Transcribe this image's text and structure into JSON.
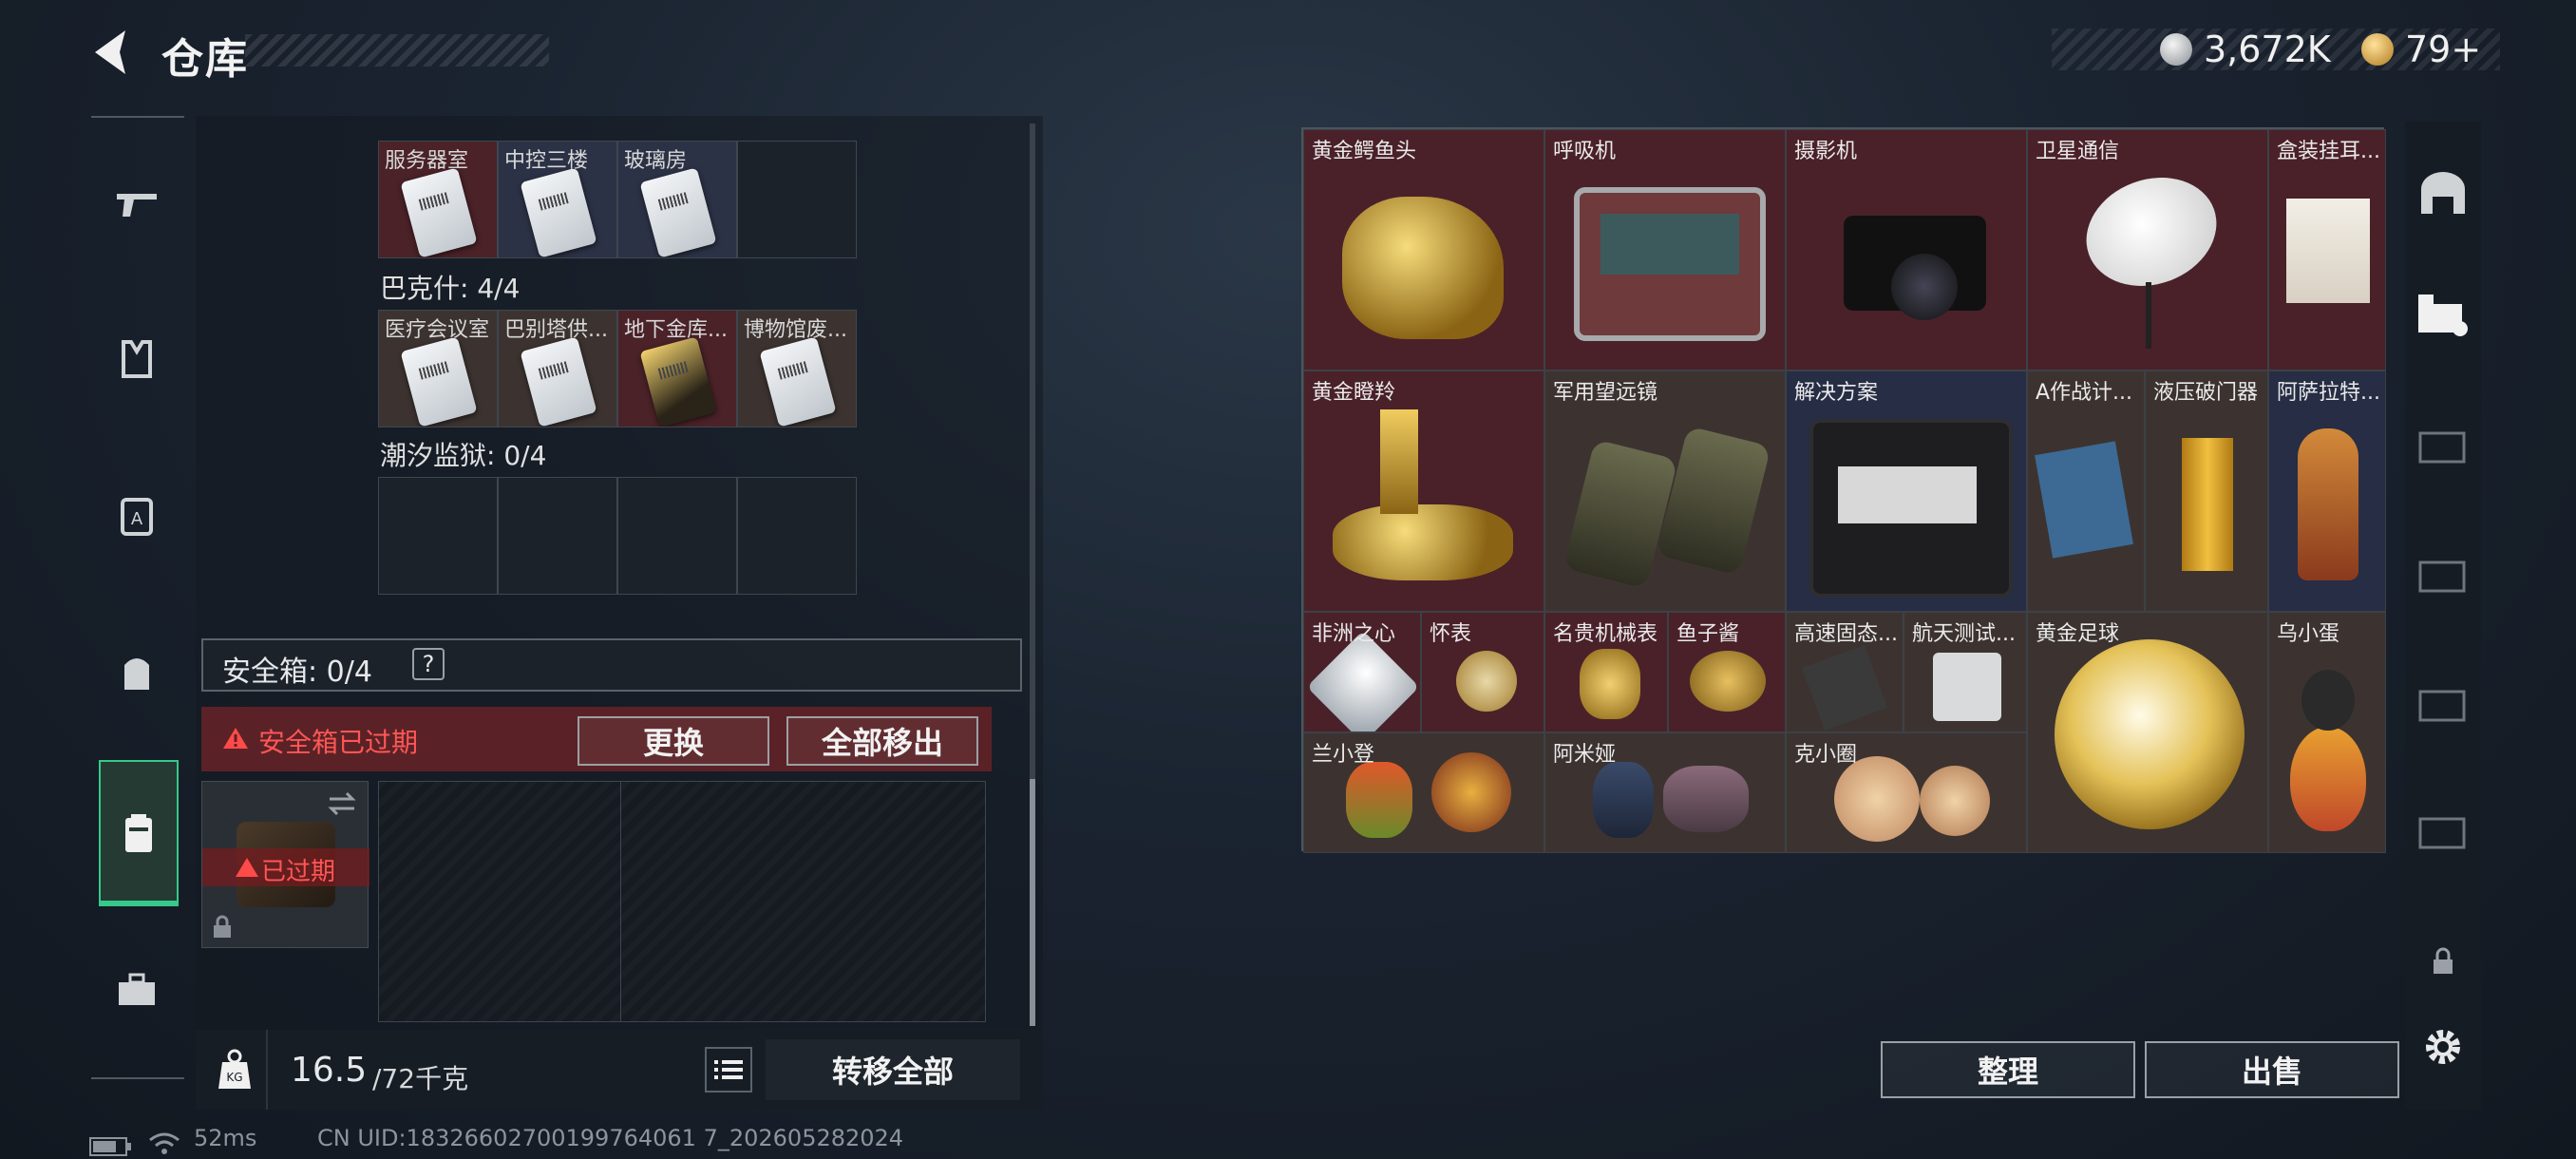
{
  "header": {
    "title": "仓库"
  },
  "currency": [
    {
      "icon": "silver-coin-icon",
      "value": "3,672K",
      "color": "#c9ccd0"
    },
    {
      "icon": "gold-coin-icon",
      "value": "79+",
      "color": "#d9a53a"
    }
  ],
  "nav": [
    {
      "icon": "gun-icon"
    },
    {
      "icon": "vest-icon"
    },
    {
      "icon": "armor-icon"
    },
    {
      "icon": "backpack-icon"
    },
    {
      "icon": "safe-box-icon",
      "active": true
    },
    {
      "icon": "toolbox-icon"
    }
  ],
  "keys": {
    "top_cut_label": "服务器室",
    "top_row": [
      "服务器室",
      "中控三楼",
      "玻璃房"
    ],
    "bakesh_label": "巴克什: 4/4",
    "bakesh_row": [
      "医疗会议室",
      "巴别塔供...",
      "地下金库...",
      "博物馆废..."
    ],
    "tide_label": "潮汐监狱: 0/4"
  },
  "safe": {
    "label": "安全箱: 0/4",
    "help": "?",
    "expired_warning": "安全箱已过期",
    "replace_button": "更换",
    "remove_all_button": "全部移出",
    "expired_badge": "已过期"
  },
  "bottom": {
    "weight_value": "16.5",
    "weight_max": "/72千克",
    "transfer_all": "转移全部"
  },
  "items": {
    "golden_croc": "黄金鳄鱼头",
    "respirator": "呼吸机",
    "camera": "摄影机",
    "satellite": "卫星通信",
    "boxed_earphones": "盒装挂耳...",
    "golden_deer": "黄金瞪羚",
    "binoculars": "军用望远镜",
    "solution": "解决方案",
    "a_plan": "A作战计...",
    "breacher": "液压破门器",
    "lantern": "阿萨拉特...",
    "africa_heart": "非洲之心",
    "pocket_watch": "怀表",
    "luxury_watch": "名贵机械表",
    "caviar": "鱼子酱",
    "ssd": "高速固态...",
    "aero_test": "航天测试...",
    "golden_ball": "黄金足球",
    "wu_egg": "乌小蛋",
    "lan_xiaodeng": "兰小登",
    "amiya": "阿米娅",
    "ke_xiaoquan": "克小圈"
  },
  "actions": {
    "sort": "整理",
    "sell": "出售"
  },
  "status": {
    "ping": "52ms",
    "uid": "CN UID:18326602700199764061 7_202605282024"
  }
}
